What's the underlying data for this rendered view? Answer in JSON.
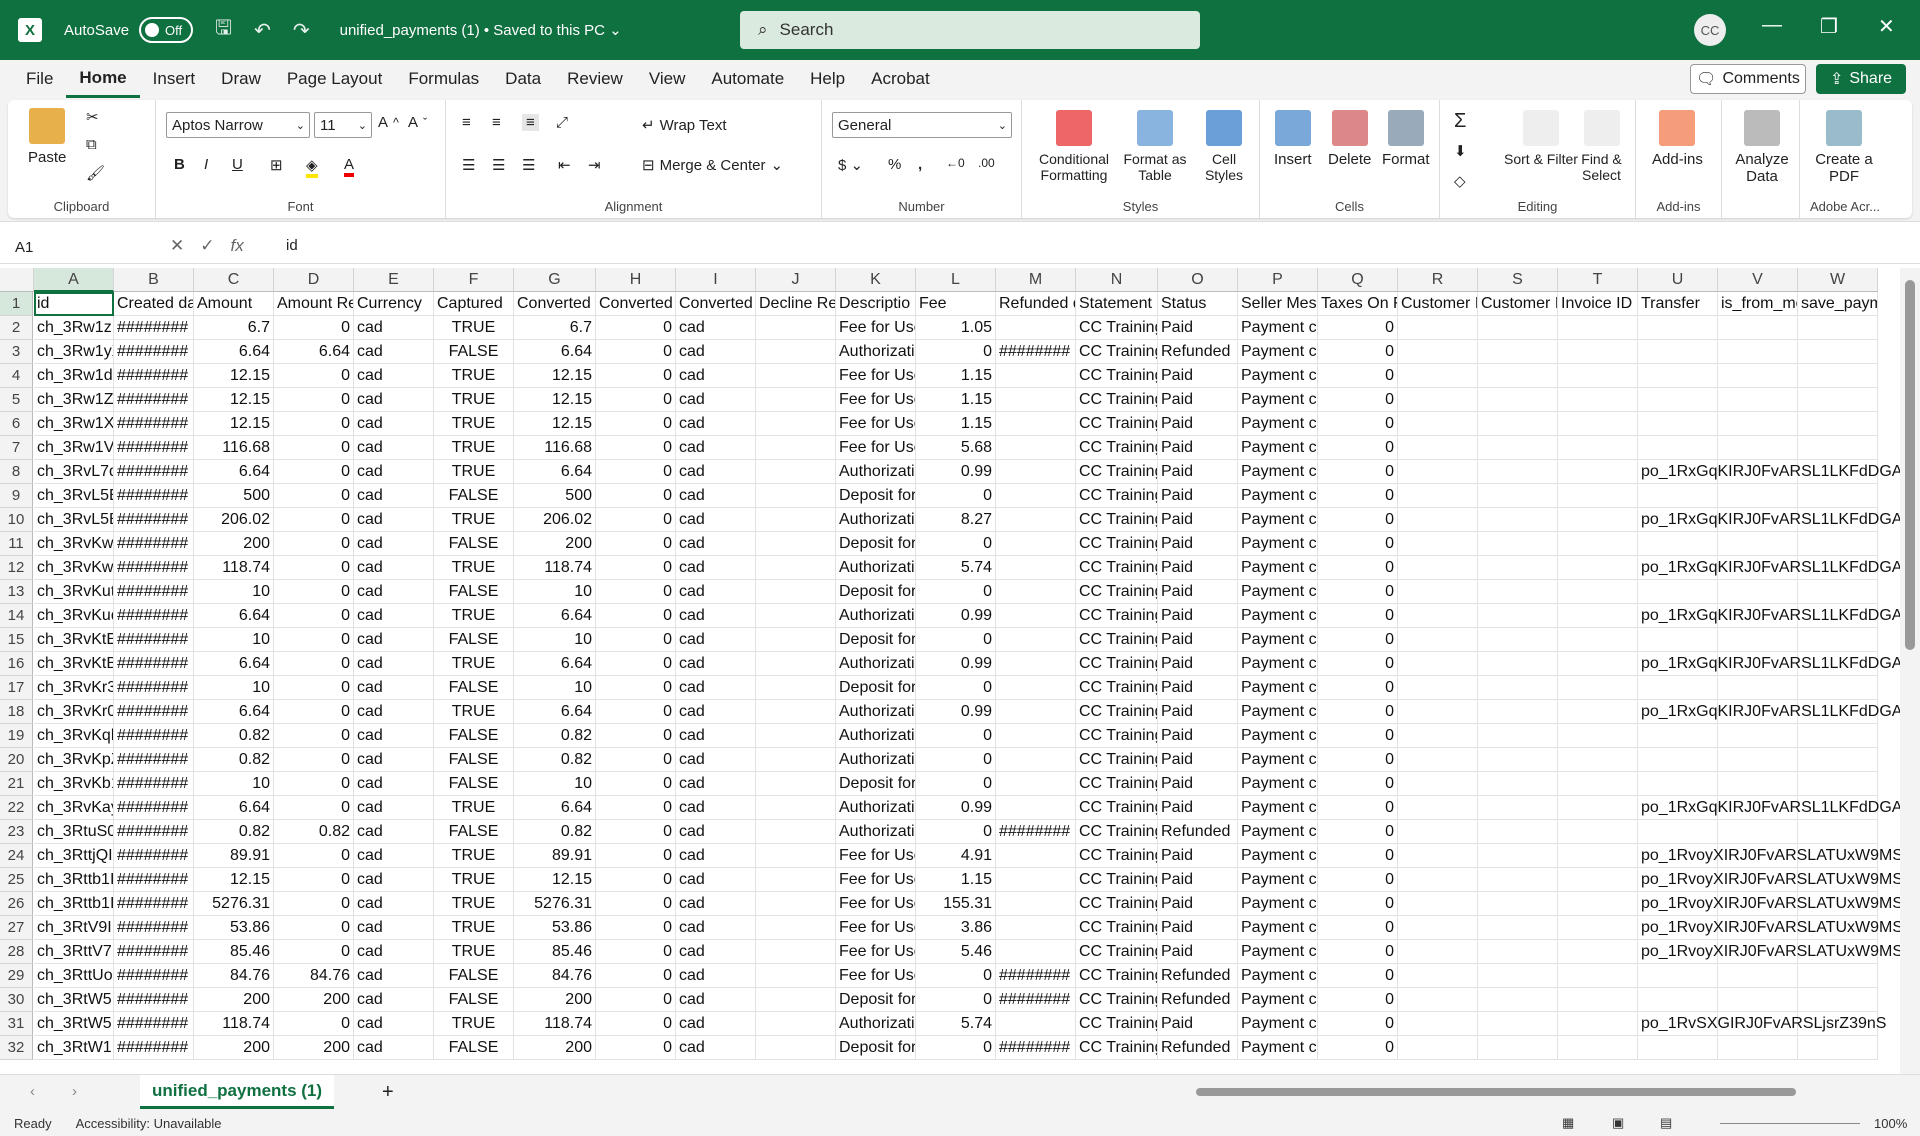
{
  "titlebar": {
    "autosave_label": "AutoSave",
    "autosave_state": "Off",
    "filename": "unified_payments (1) • Saved to this PC ⌄",
    "search_placeholder": "Search",
    "user_initials": "CC"
  },
  "menu": [
    "File",
    "Home",
    "Insert",
    "Draw",
    "Page Layout",
    "Formulas",
    "Data",
    "Review",
    "View",
    "Automate",
    "Help",
    "Acrobat"
  ],
  "menu_active": "Home",
  "comments_label": "Comments",
  "share_label": "Share",
  "ribbon": {
    "clipboard": {
      "paste": "Paste",
      "label": "Clipboard"
    },
    "font": {
      "name": "Aptos Narrow",
      "size": "11",
      "label": "Font"
    },
    "alignment": {
      "wrap": "Wrap Text",
      "merge": "Merge & Center",
      "label": "Alignment"
    },
    "number": {
      "format": "General",
      "label": "Number"
    },
    "styles": {
      "cond": "Conditional Formatting",
      "table": "Format as Table",
      "cell": "Cell Styles",
      "label": "Styles"
    },
    "cells": {
      "insert": "Insert",
      "delete": "Delete",
      "format": "Format",
      "label": "Cells"
    },
    "editing": {
      "sort": "Sort & Filter",
      "find": "Find & Select",
      "label": "Editing"
    },
    "addins": {
      "btn": "Add-ins",
      "label": "Add-ins"
    },
    "analyze": {
      "btn": "Analyze Data"
    },
    "acrobat": {
      "btn": "Create a PDF",
      "label": "Adobe Acr..."
    }
  },
  "formula_bar": {
    "name_box": "A1",
    "value": "id"
  },
  "columns": [
    "A",
    "B",
    "C",
    "D",
    "E",
    "F",
    "G",
    "H",
    "I",
    "J",
    "K",
    "L",
    "M",
    "N",
    "O",
    "P",
    "Q",
    "R",
    "S",
    "T",
    "U",
    "V",
    "W"
  ],
  "header_row": [
    "id",
    "Created da",
    "Amount",
    "Amount Re",
    "Currency",
    "Captured",
    "Converted",
    "Converted",
    "Converted",
    "Decline Re",
    "Descriptio",
    "Fee",
    "Refunded d",
    "Statement",
    "Status",
    "Seller Mes",
    "Taxes On F",
    "Customer I",
    "Customer I",
    "Invoice ID",
    "Transfer",
    "is_from_me",
    "save_paym"
  ],
  "rows": [
    [
      "ch_3Rw1zI",
      "########",
      "6.7",
      "0",
      "cad",
      "TRUE",
      "6.7",
      "0",
      "cad",
      "",
      "Fee for Use",
      "1.05",
      "",
      "CC Training",
      "Paid",
      "Payment c",
      "0",
      "",
      "",
      "",
      "",
      "",
      ""
    ],
    [
      "ch_3Rw1yX",
      "########",
      "6.64",
      "6.64",
      "cad",
      "FALSE",
      "6.64",
      "0",
      "cad",
      "",
      "Authorizati",
      "0",
      "########",
      "CC Training",
      "Refunded",
      "Payment c",
      "0",
      "",
      "",
      "",
      "",
      "",
      ""
    ],
    [
      "ch_3Rw1dI",
      "########",
      "12.15",
      "0",
      "cad",
      "TRUE",
      "12.15",
      "0",
      "cad",
      "",
      "Fee for Use",
      "1.15",
      "",
      "CC Training",
      "Paid",
      "Payment c",
      "0",
      "",
      "",
      "",
      "",
      "",
      ""
    ],
    [
      "ch_3Rw1ZT",
      "########",
      "12.15",
      "0",
      "cad",
      "TRUE",
      "12.15",
      "0",
      "cad",
      "",
      "Fee for Use",
      "1.15",
      "",
      "CC Training",
      "Paid",
      "Payment c",
      "0",
      "",
      "",
      "",
      "",
      "",
      ""
    ],
    [
      "ch_3Rw1XI",
      "########",
      "12.15",
      "0",
      "cad",
      "TRUE",
      "12.15",
      "0",
      "cad",
      "",
      "Fee for Use",
      "1.15",
      "",
      "CC Training",
      "Paid",
      "Payment c",
      "0",
      "",
      "",
      "",
      "",
      "",
      ""
    ],
    [
      "ch_3Rw1V",
      "########",
      "116.68",
      "0",
      "cad",
      "TRUE",
      "116.68",
      "0",
      "cad",
      "",
      "Fee for Use",
      "5.68",
      "",
      "CC Training",
      "Paid",
      "Payment c",
      "0",
      "",
      "",
      "",
      "",
      "",
      ""
    ],
    [
      "ch_3RvL7q",
      "########",
      "6.64",
      "0",
      "cad",
      "TRUE",
      "6.64",
      "0",
      "cad",
      "",
      "Authorizati",
      "0.99",
      "",
      "CC Training",
      "Paid",
      "Payment c",
      "0",
      "",
      "",
      "",
      "po_1RxGqKIRJ0FvARSL1LKFdDGA",
      "",
      ""
    ],
    [
      "ch_3RvL5E",
      "########",
      "500",
      "0",
      "cad",
      "FALSE",
      "500",
      "0",
      "cad",
      "",
      "Deposit for",
      "0",
      "",
      "CC Training",
      "Paid",
      "Payment c",
      "0",
      "",
      "",
      "",
      "",
      "",
      ""
    ],
    [
      "ch_3RvL5B",
      "########",
      "206.02",
      "0",
      "cad",
      "TRUE",
      "206.02",
      "0",
      "cad",
      "",
      "Authorizati",
      "8.27",
      "",
      "CC Training",
      "Paid",
      "Payment c",
      "0",
      "",
      "",
      "",
      "po_1RxGqKIRJ0FvARSL1LKFdDGA",
      "",
      ""
    ],
    [
      "ch_3RvKwV",
      "########",
      "200",
      "0",
      "cad",
      "FALSE",
      "200",
      "0",
      "cad",
      "",
      "Deposit for",
      "0",
      "",
      "CC Training",
      "Paid",
      "Payment c",
      "0",
      "",
      "",
      "",
      "",
      "",
      ""
    ],
    [
      "ch_3RvKwI",
      "########",
      "118.74",
      "0",
      "cad",
      "TRUE",
      "118.74",
      "0",
      "cad",
      "",
      "Authorizati",
      "5.74",
      "",
      "CC Training",
      "Paid",
      "Payment c",
      "0",
      "",
      "",
      "",
      "po_1RxGqKIRJ0FvARSL1LKFdDGA",
      "",
      ""
    ],
    [
      "ch_3RvKutI",
      "########",
      "10",
      "0",
      "cad",
      "FALSE",
      "10",
      "0",
      "cad",
      "",
      "Deposit for",
      "0",
      "",
      "CC Training",
      "Paid",
      "Payment c",
      "0",
      "",
      "",
      "",
      "",
      "",
      ""
    ],
    [
      "ch_3RvKuq",
      "########",
      "6.64",
      "0",
      "cad",
      "TRUE",
      "6.64",
      "0",
      "cad",
      "",
      "Authorizati",
      "0.99",
      "",
      "CC Training",
      "Paid",
      "Payment c",
      "0",
      "",
      "",
      "",
      "po_1RxGqKIRJ0FvARSL1LKFdDGA",
      "",
      ""
    ],
    [
      "ch_3RvKtEI",
      "########",
      "10",
      "0",
      "cad",
      "FALSE",
      "10",
      "0",
      "cad",
      "",
      "Deposit for",
      "0",
      "",
      "CC Training",
      "Paid",
      "Payment c",
      "0",
      "",
      "",
      "",
      "",
      "",
      ""
    ],
    [
      "ch_3RvKtB",
      "########",
      "6.64",
      "0",
      "cad",
      "TRUE",
      "6.64",
      "0",
      "cad",
      "",
      "Authorizati",
      "0.99",
      "",
      "CC Training",
      "Paid",
      "Payment c",
      "0",
      "",
      "",
      "",
      "po_1RxGqKIRJ0FvARSL1LKFdDGA",
      "",
      ""
    ],
    [
      "ch_3RvKr3",
      "########",
      "10",
      "0",
      "cad",
      "FALSE",
      "10",
      "0",
      "cad",
      "",
      "Deposit for",
      "0",
      "",
      "CC Training",
      "Paid",
      "Payment c",
      "0",
      "",
      "",
      "",
      "",
      "",
      ""
    ],
    [
      "ch_3RvKr0",
      "########",
      "6.64",
      "0",
      "cad",
      "TRUE",
      "6.64",
      "0",
      "cad",
      "",
      "Authorizati",
      "0.99",
      "",
      "CC Training",
      "Paid",
      "Payment c",
      "0",
      "",
      "",
      "",
      "po_1RxGqKIRJ0FvARSL1LKFdDGA",
      "",
      ""
    ],
    [
      "ch_3RvKqlI",
      "########",
      "0.82",
      "0",
      "cad",
      "FALSE",
      "0.82",
      "0",
      "cad",
      "",
      "Authorizati",
      "0",
      "",
      "CC Training",
      "Paid",
      "Payment c",
      "0",
      "",
      "",
      "",
      "",
      "",
      ""
    ],
    [
      "ch_3RvKpZ",
      "########",
      "0.82",
      "0",
      "cad",
      "FALSE",
      "0.82",
      "0",
      "cad",
      "",
      "Authorizati",
      "0",
      "",
      "CC Training",
      "Paid",
      "Payment c",
      "0",
      "",
      "",
      "",
      "",
      "",
      ""
    ],
    [
      "ch_3RvKb1",
      "########",
      "10",
      "0",
      "cad",
      "FALSE",
      "10",
      "0",
      "cad",
      "",
      "Deposit for",
      "0",
      "",
      "CC Training",
      "Paid",
      "Payment c",
      "0",
      "",
      "",
      "",
      "",
      "",
      ""
    ],
    [
      "ch_3RvKay",
      "########",
      "6.64",
      "0",
      "cad",
      "TRUE",
      "6.64",
      "0",
      "cad",
      "",
      "Authorizati",
      "0.99",
      "",
      "CC Training",
      "Paid",
      "Payment c",
      "0",
      "",
      "",
      "",
      "po_1RxGqKIRJ0FvARSL1LKFdDGA",
      "",
      ""
    ],
    [
      "ch_3RtuS0",
      "########",
      "0.82",
      "0.82",
      "cad",
      "FALSE",
      "0.82",
      "0",
      "cad",
      "",
      "Authorizati",
      "0",
      "########",
      "CC Training",
      "Refunded",
      "Payment c",
      "0",
      "",
      "",
      "",
      "",
      "",
      ""
    ],
    [
      "ch_3RttjQI",
      "########",
      "89.91",
      "0",
      "cad",
      "TRUE",
      "89.91",
      "0",
      "cad",
      "",
      "Fee for Use",
      "4.91",
      "",
      "CC Training",
      "Paid",
      "Payment c",
      "0",
      "",
      "",
      "",
      "po_1RvoyXIRJ0FvARSLATUxW9MS",
      "",
      ""
    ],
    [
      "ch_3Rttb1I",
      "########",
      "12.15",
      "0",
      "cad",
      "TRUE",
      "12.15",
      "0",
      "cad",
      "",
      "Fee for Use",
      "1.15",
      "",
      "CC Training",
      "Paid",
      "Payment c",
      "0",
      "",
      "",
      "",
      "po_1RvoyXIRJ0FvARSLATUxW9MS",
      "",
      ""
    ],
    [
      "ch_3Rttb1I",
      "########",
      "5276.31",
      "0",
      "cad",
      "TRUE",
      "5276.31",
      "0",
      "cad",
      "",
      "Fee for Use",
      "155.31",
      "",
      "CC Training",
      "Paid",
      "Payment c",
      "0",
      "",
      "",
      "",
      "po_1RvoyXIRJ0FvARSLATUxW9MS",
      "",
      ""
    ],
    [
      "ch_3RtV9I",
      "########",
      "53.86",
      "0",
      "cad",
      "TRUE",
      "53.86",
      "0",
      "cad",
      "",
      "Fee for Use",
      "3.86",
      "",
      "CC Training",
      "Paid",
      "Payment c",
      "0",
      "",
      "",
      "",
      "po_1RvoyXIRJ0FvARSLATUxW9MS",
      "",
      ""
    ],
    [
      "ch_3RttV7I",
      "########",
      "85.46",
      "0",
      "cad",
      "TRUE",
      "85.46",
      "0",
      "cad",
      "",
      "Fee for Use",
      "5.46",
      "",
      "CC Training",
      "Paid",
      "Payment c",
      "0",
      "",
      "",
      "",
      "po_1RvoyXIRJ0FvARSLATUxW9MS",
      "",
      ""
    ],
    [
      "ch_3RttUoI",
      "########",
      "84.76",
      "84.76",
      "cad",
      "FALSE",
      "84.76",
      "0",
      "cad",
      "",
      "Fee for Use",
      "0",
      "########",
      "CC Training",
      "Refunded",
      "Payment c",
      "0",
      "",
      "",
      "",
      "",
      "",
      ""
    ],
    [
      "ch_3RtW5I",
      "########",
      "200",
      "200",
      "cad",
      "FALSE",
      "200",
      "0",
      "cad",
      "",
      "Deposit for",
      "0",
      "########",
      "CC Training",
      "Refunded",
      "Payment c",
      "0",
      "",
      "",
      "",
      "",
      "",
      ""
    ],
    [
      "ch_3RtW5I",
      "########",
      "118.74",
      "0",
      "cad",
      "TRUE",
      "118.74",
      "0",
      "cad",
      "",
      "Authorizati",
      "5.74",
      "",
      "CC Training",
      "Paid",
      "Payment c",
      "0",
      "",
      "",
      "",
      "po_1RvSXGIRJ0FvARSLjsrZ39nS",
      "",
      ""
    ],
    [
      "ch_3RtW1I",
      "########",
      "200",
      "200",
      "cad",
      "FALSE",
      "200",
      "0",
      "cad",
      "",
      "Deposit for",
      "0",
      "########",
      "CC Training",
      "Refunded",
      "Payment c",
      "0",
      "",
      "",
      "",
      "",
      "",
      ""
    ]
  ],
  "sheet_tab": "unified_payments (1)",
  "status": {
    "ready": "Ready",
    "accessibility": "Accessibility: Unavailable",
    "zoom": "100%"
  }
}
